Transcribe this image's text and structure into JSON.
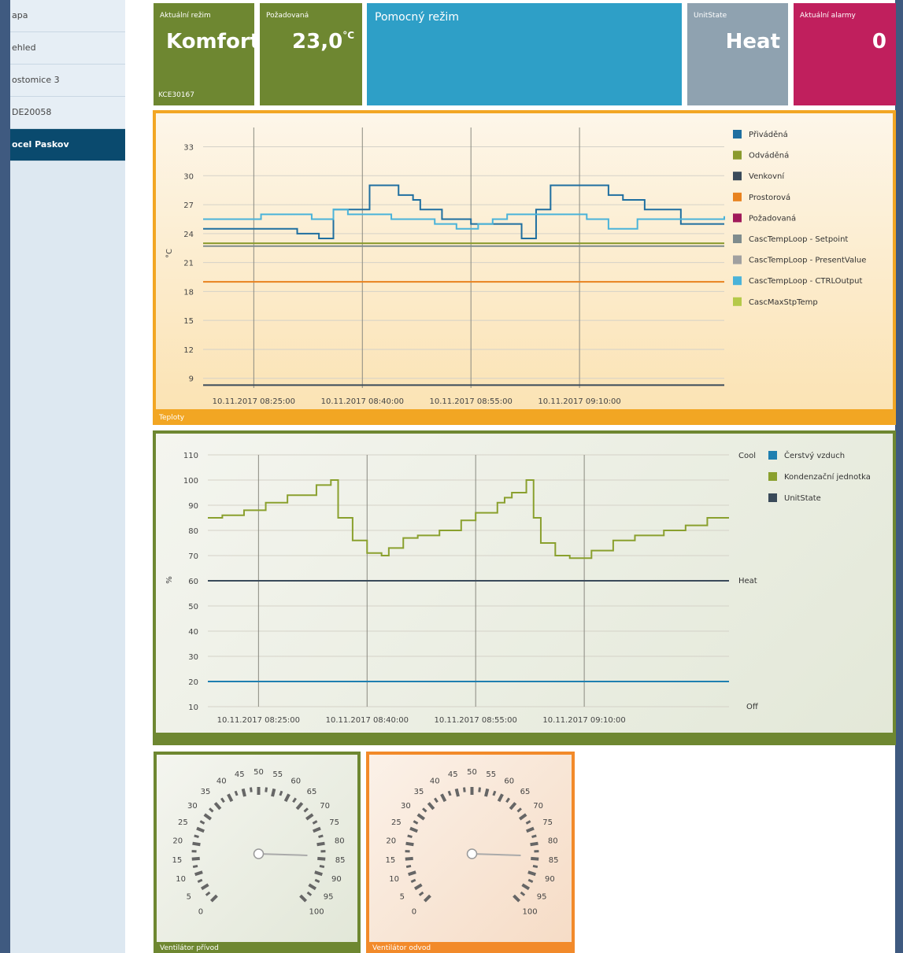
{
  "sidebar": {
    "items": [
      {
        "label": "apa",
        "active": false
      },
      {
        "label": "ehled",
        "active": false
      },
      {
        "label": "ostomice 3",
        "active": false
      },
      {
        "label": "DE20058",
        "active": false
      },
      {
        "label": "ocel Paskov",
        "active": true
      }
    ]
  },
  "tiles": {
    "mode": {
      "caption": "Aktuální režim",
      "value": "Komfort",
      "footer": "KCE30167",
      "color": "#6e8731"
    },
    "setpoint": {
      "caption": "Požadovaná",
      "value": "23,0",
      "unit": "°C",
      "color": "#6e8731"
    },
    "aux": {
      "caption": "Pomocný režim",
      "color": "#2e9fc7"
    },
    "unit_state": {
      "caption": "UnitState",
      "value": "Heat",
      "color": "#8fa2b0"
    },
    "alarms": {
      "caption": "Aktuální alarmy",
      "value": "0",
      "color": "#c01f5d"
    }
  },
  "temp_panel": {
    "footer": "Teploty",
    "border_color": "#f2a623",
    "ylabel": "°C"
  },
  "pct_panel": {
    "ylabel": "%",
    "border_color": "#6e8731",
    "right_labels": {
      "cool": "Cool",
      "heat": "Heat",
      "off": "Off"
    }
  },
  "gauges": [
    {
      "footer": "Ventilátor přívod",
      "value": 84,
      "border_color": "#6e8731",
      "ticks": [
        "0",
        "5",
        "10",
        "15",
        "20",
        "25",
        "30",
        "35",
        "40",
        "45",
        "50",
        "55",
        "60",
        "65",
        "70",
        "75",
        "80",
        "85",
        "90",
        "95",
        "100"
      ]
    },
    {
      "footer": "Ventilátor odvod",
      "value": 84,
      "border_color": "#f28a2a",
      "ticks": [
        "0",
        "5",
        "10",
        "15",
        "20",
        "25",
        "30",
        "35",
        "40",
        "45",
        "50",
        "55",
        "60",
        "65",
        "70",
        "75",
        "80",
        "85",
        "90",
        "95",
        "100"
      ]
    }
  ],
  "chart_data": [
    {
      "type": "line",
      "yticks": [
        "9",
        "12",
        "15",
        "18",
        "21",
        "24",
        "27",
        "30",
        "33"
      ],
      "ylim": [
        8,
        35
      ],
      "xticks": [
        "10.11.2017 08:25:00",
        "10.11.2017 08:40:00",
        "10.11.2017 08:55:00",
        "10.11.2017 09:10:00"
      ],
      "xlim": [
        "10.11.2017 08:18:00",
        "10.11.2017 09:30:00"
      ],
      "grid": true,
      "legend_position": "right",
      "series": [
        {
          "name": "Přiváděná",
          "color": "#1f6fa0",
          "x": [
            "08:18",
            "08:30",
            "08:31",
            "08:34",
            "08:35",
            "08:36",
            "08:41",
            "08:42",
            "08:43",
            "08:45",
            "08:47",
            "08:48",
            "08:51",
            "08:55",
            "08:56",
            "08:57",
            "08:58",
            "09:02",
            "09:03",
            "09:04",
            "09:06",
            "09:09",
            "09:11",
            "09:14",
            "09:16",
            "09:19",
            "09:24",
            "09:30"
          ],
          "y": [
            24.5,
            24.5,
            24.0,
            23.5,
            23.5,
            26.5,
            29,
            29,
            29,
            28.0,
            27.5,
            26.5,
            25.5,
            25.0,
            25.0,
            25.0,
            25.0,
            23.5,
            23.5,
            26.5,
            29,
            29,
            29,
            28.0,
            27.5,
            26.5,
            25.0,
            25.0
          ]
        },
        {
          "name": "Odváděná",
          "color": "#8a9a2e",
          "x": [
            "08:18",
            "09:30"
          ],
          "y": [
            23.0,
            23.0
          ]
        },
        {
          "name": "Venkovní",
          "color": "#3a4a5a",
          "x": [
            "08:18",
            "09:30"
          ],
          "y": [
            8.3,
            8.3
          ]
        },
        {
          "name": "Prostorová",
          "color": "#e8821e",
          "x": [
            "08:18",
            "09:30"
          ],
          "y": [
            19.0,
            19.0
          ]
        },
        {
          "name": "Požadovaná",
          "color": "#a01a5a",
          "x": [],
          "y": []
        },
        {
          "name": "CascTempLoop - Setpoint",
          "color": "#7f8c8d",
          "x": [
            "08:18",
            "09:30"
          ],
          "y": [
            22.7,
            22.7
          ]
        },
        {
          "name": "CascTempLoop - PresentValue",
          "color": "#a0a0a0",
          "x": [],
          "y": []
        },
        {
          "name": "CascTempLoop - CTRLOutput",
          "color": "#4ab3d9",
          "x": [
            "08:18",
            "08:25",
            "08:26",
            "08:33",
            "08:36",
            "08:38",
            "08:44",
            "08:48",
            "08:50",
            "08:53",
            "08:56",
            "08:58",
            "09:00",
            "09:08",
            "09:11",
            "09:14",
            "09:18",
            "09:24",
            "09:30"
          ],
          "y": [
            25.5,
            25.5,
            26.0,
            25.5,
            26.5,
            26.0,
            25.5,
            25.5,
            25.0,
            24.5,
            25.0,
            25.5,
            26.0,
            26.0,
            25.5,
            24.5,
            25.5,
            25.5,
            25.8
          ]
        },
        {
          "name": "CascMaxStpTemp",
          "color": "#b5c94a",
          "x": [],
          "y": []
        }
      ]
    },
    {
      "type": "line",
      "yticks": [
        "10",
        "20",
        "30",
        "40",
        "50",
        "60",
        "70",
        "80",
        "90",
        "100",
        "110"
      ],
      "ylim": [
        10,
        110
      ],
      "xticks": [
        "10.11.2017 08:25:00",
        "10.11.2017 08:40:00",
        "10.11.2017 08:55:00",
        "10.11.2017 09:10:00"
      ],
      "xlim": [
        "10.11.2017 08:18:00",
        "10.11.2017 09:30:00"
      ],
      "grid": true,
      "legend_position": "right",
      "series": [
        {
          "name": "Čerstvý vzduch",
          "color": "#1f7fb0",
          "x": [
            "08:18",
            "09:30"
          ],
          "y": [
            20,
            20
          ]
        },
        {
          "name": "Kondenzační jednotka",
          "color": "#8aa02e",
          "x": [
            "08:18",
            "08:20",
            "08:23",
            "08:26",
            "08:29",
            "08:33",
            "08:35",
            "08:36",
            "08:38",
            "08:40",
            "08:42",
            "08:43",
            "08:45",
            "08:47",
            "08:50",
            "08:53",
            "08:55",
            "08:58",
            "08:59",
            "09:00",
            "09:02",
            "09:03",
            "09:04",
            "09:06",
            "09:08",
            "09:11",
            "09:14",
            "09:17",
            "09:21",
            "09:24",
            "09:27",
            "09:30"
          ],
          "y": [
            85,
            86,
            88,
            91,
            94,
            98,
            100,
            85,
            76,
            71,
            70,
            73,
            77,
            78,
            80,
            84,
            87,
            91,
            93,
            95,
            100,
            85,
            75,
            70,
            69,
            72,
            76,
            78,
            80,
            82,
            85,
            85
          ]
        },
        {
          "name": "UnitState",
          "color": "#3a4a5a",
          "x": [
            "08:18",
            "09:30"
          ],
          "y": [
            60,
            60
          ]
        }
      ]
    }
  ]
}
